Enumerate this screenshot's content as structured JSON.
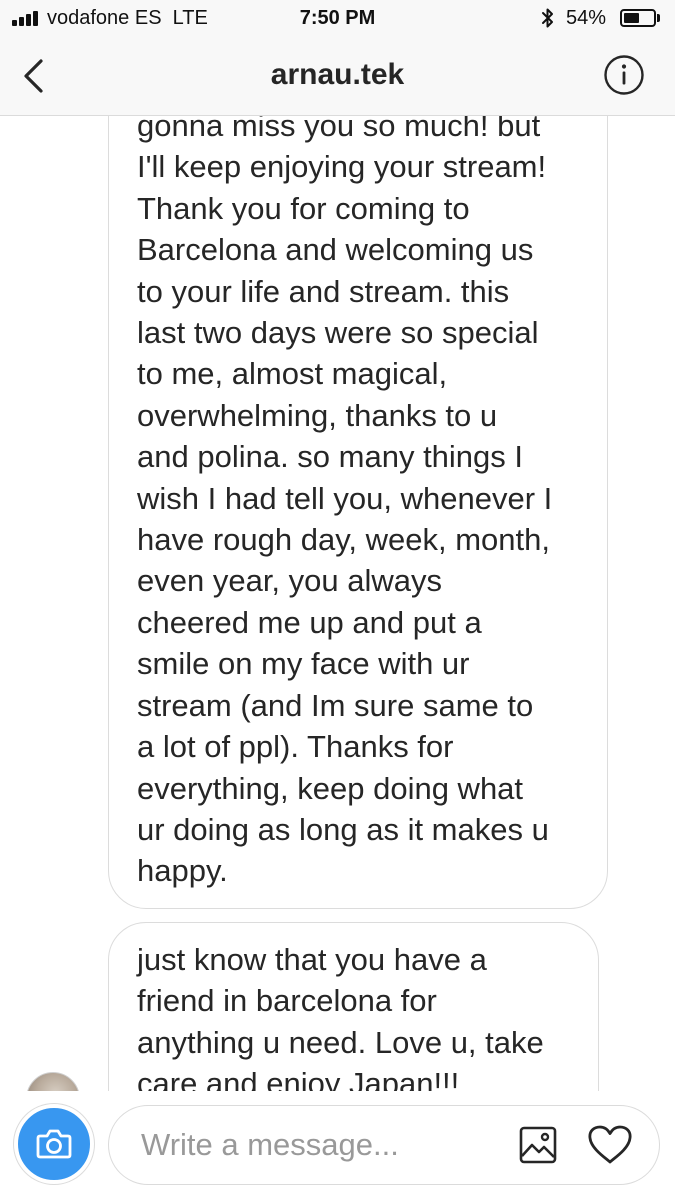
{
  "status_bar": {
    "carrier": "vodafone ES",
    "network": "LTE",
    "time": "7:50 PM",
    "battery_percent": "54%",
    "battery_level": 0.54,
    "signal_bars": 4
  },
  "header": {
    "title": "arnau.tek",
    "back_icon": "chevron-left-icon",
    "info_icon": "info-circle-icon"
  },
  "messages": [
    {
      "text": "gonna miss you so much! but\nI'll keep enjoying your stream!\nThank you for coming to\nBarcelona and welcoming us\nto your life and stream. this\nlast two days were so special\nto me, almost magical,\noverwhelming, thanks to u\nand polina. so many things I\nwish I had tell you, whenever I\nhave rough day, week, month,\neven year, you always\ncheered me up and put a\nsmile on my face with ur\nstream (and Im sure same to\na lot of ppl). Thanks for\neverything, keep doing what\nur doing as long as it makes u\nhappy."
    },
    {
      "text": "just know that you have a\nfriend in barcelona for\nanything u need. Love u, take\ncare and enjoy Japan!!!"
    }
  ],
  "composer": {
    "placeholder": "Write a message...",
    "camera_icon": "camera-icon",
    "gallery_icon": "image-icon",
    "like_icon": "heart-icon"
  },
  "colors": {
    "accent": "#3897f0",
    "bubble_border": "#dcdcdc",
    "text": "#262626",
    "placeholder": "#999999"
  }
}
